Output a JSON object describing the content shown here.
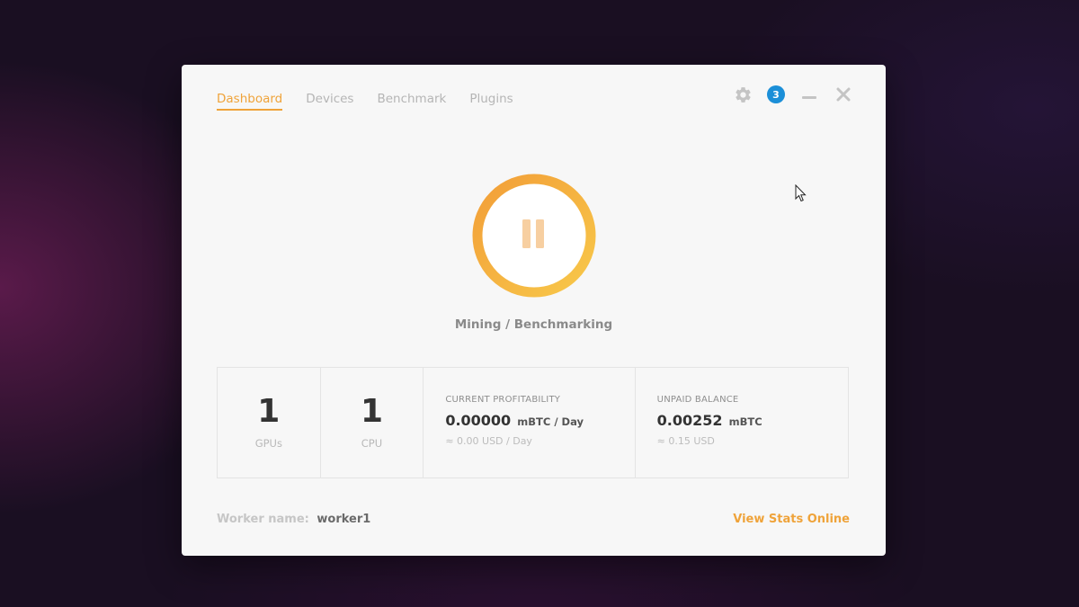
{
  "nav": {
    "tabs": [
      {
        "label": "Dashboard",
        "active": true
      },
      {
        "label": "Devices",
        "active": false
      },
      {
        "label": "Benchmark",
        "active": false
      },
      {
        "label": "Plugins",
        "active": false
      }
    ]
  },
  "controls": {
    "settings_icon": "gear-icon",
    "notification_count": "3",
    "minimize_icon": "minimize-icon",
    "close_icon": "close-icon"
  },
  "mining": {
    "button_icon": "pause-icon",
    "status": "Mining / Benchmarking"
  },
  "stats": {
    "gpus": {
      "value": "1",
      "label": "GPUs"
    },
    "cpu": {
      "value": "1",
      "label": "CPU"
    },
    "profitability": {
      "title": "CURRENT PROFITABILITY",
      "value": "0.00000",
      "unit": "mBTC / Day",
      "sub": "≈ 0.00 USD / Day"
    },
    "balance": {
      "title": "UNPAID BALANCE",
      "value": "0.00252",
      "unit": "mBTC",
      "sub": "≈ 0.15 USD"
    }
  },
  "footer": {
    "worker_label": "Worker name:",
    "worker_value": "worker1",
    "view_stats": "View Stats Online"
  },
  "colors": {
    "accent": "#efa33a",
    "badge": "#1b8fd8",
    "ring_start": "#f3a23a",
    "ring_end": "#f8c84a"
  }
}
